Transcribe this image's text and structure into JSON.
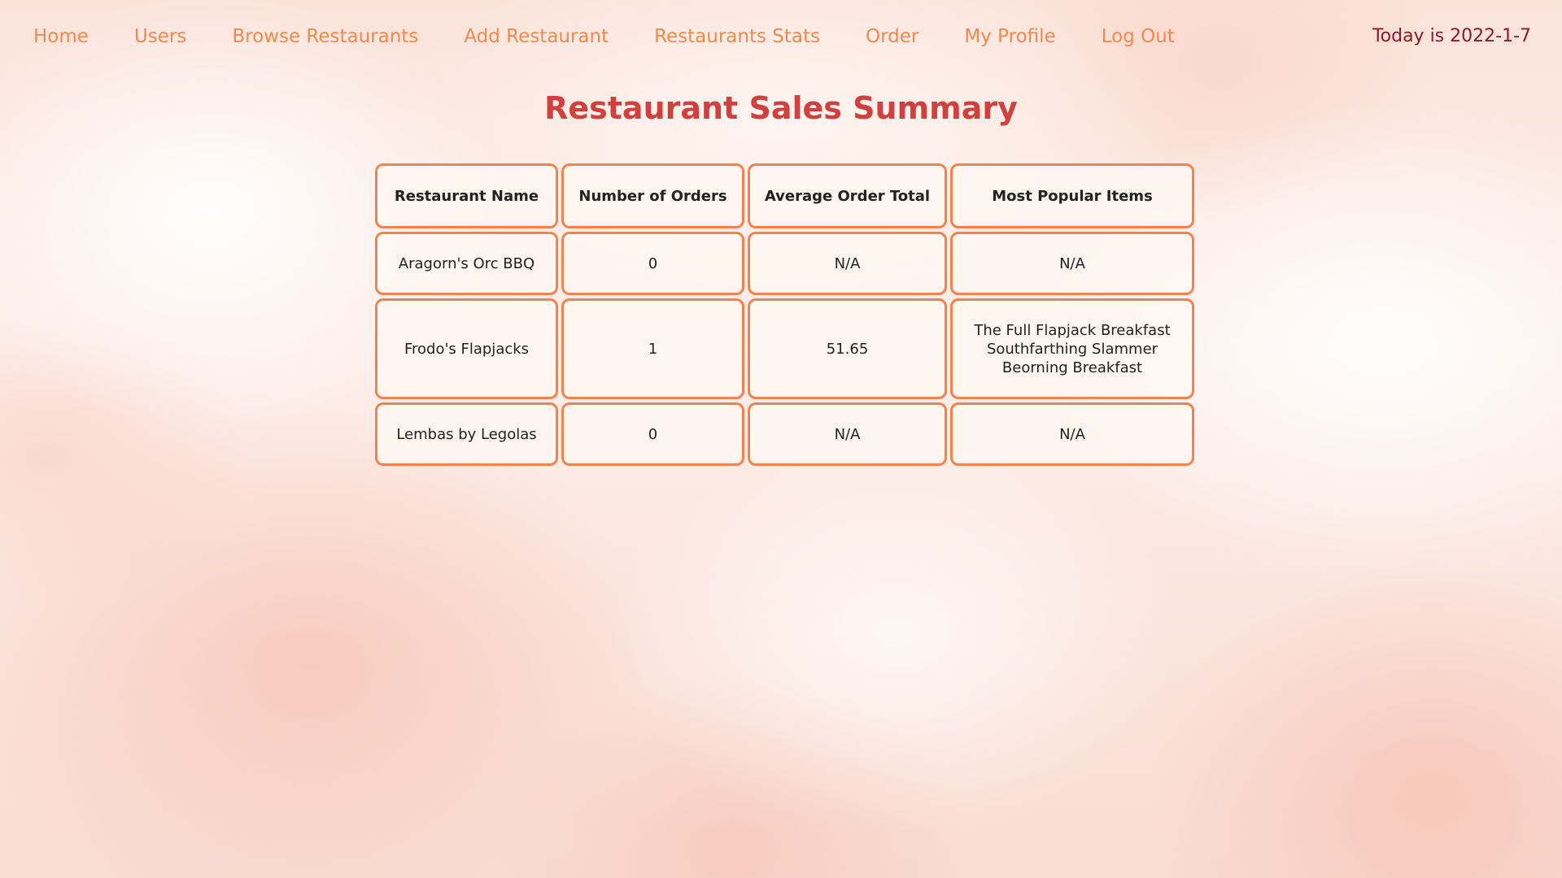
{
  "nav": {
    "links": [
      "Home",
      "Users",
      "Browse Restaurants",
      "Add Restaurant",
      "Restaurants Stats",
      "Order",
      "My Profile",
      "Log Out"
    ],
    "date_text": "Today is 2022-1-7"
  },
  "page": {
    "title": "Restaurant Sales Summary"
  },
  "table": {
    "headers": [
      "Restaurant Name",
      "Number of Orders",
      "Average Order Total",
      "Most Popular Items"
    ],
    "rows": [
      {
        "name": "Aragorn's Orc BBQ",
        "orders": "0",
        "avg_total": "N/A",
        "popular_items": [
          "N/A"
        ]
      },
      {
        "name": "Frodo's Flapjacks",
        "orders": "1",
        "avg_total": "51.65",
        "popular_items": [
          "The Full Flapjack Breakfast",
          "Southfarthing Slammer",
          "Beorning Breakfast"
        ]
      },
      {
        "name": "Lembas by Legolas",
        "orders": "0",
        "avg_total": "N/A",
        "popular_items": [
          "N/A"
        ]
      }
    ]
  },
  "colors": {
    "nav_link": "#f08a4e",
    "date": "#8b1a2a",
    "title": "#d0403f",
    "cell_border": "#f2834e"
  }
}
